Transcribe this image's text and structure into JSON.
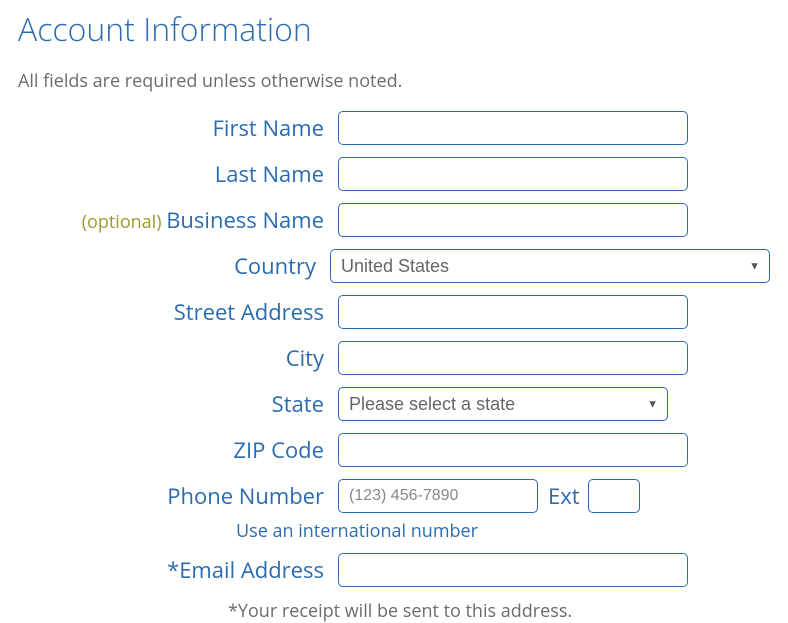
{
  "heading": "Account Information",
  "subtitle": "All fields are required unless otherwise noted.",
  "labels": {
    "first_name": "First Name",
    "last_name": "Last Name",
    "optional_prefix": "(optional) ",
    "business_name": "Business Name",
    "country": "Country",
    "street_address": "Street Address",
    "city": "City",
    "state": "State",
    "zip_code": "ZIP Code",
    "phone_number": "Phone Number",
    "ext": "Ext",
    "email_address": "*Email Address"
  },
  "values": {
    "country_selected": "United States",
    "state_selected": "Please select a state",
    "phone_placeholder": "(123) 456-7890"
  },
  "helper": {
    "intl": "Use an international number"
  },
  "footnote": "*Your receipt will be sent to this address."
}
